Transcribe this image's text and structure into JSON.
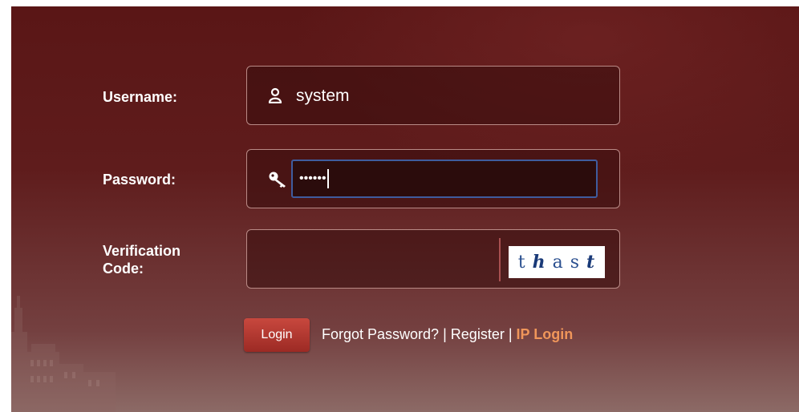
{
  "form": {
    "username_label": "Username:",
    "username_value": "system",
    "password_label": "Password:",
    "password_value": "••••••",
    "verification_label_line1": "Verification",
    "verification_label_line2": "Code:",
    "captcha_chars": [
      "t",
      "h",
      "a",
      "s",
      "t"
    ]
  },
  "actions": {
    "login_label": "Login",
    "forgot_label": "Forgot Password?",
    "separator": "|",
    "register_label": "Register",
    "ip_login_label": "IP Login"
  },
  "colors": {
    "background": "#5f1c1c",
    "accent_link": "#f0965a",
    "login_button": "#b23a32",
    "focus_border": "#3f5c9e"
  },
  "icons": {
    "username": "user-icon",
    "password": "key-icon"
  }
}
